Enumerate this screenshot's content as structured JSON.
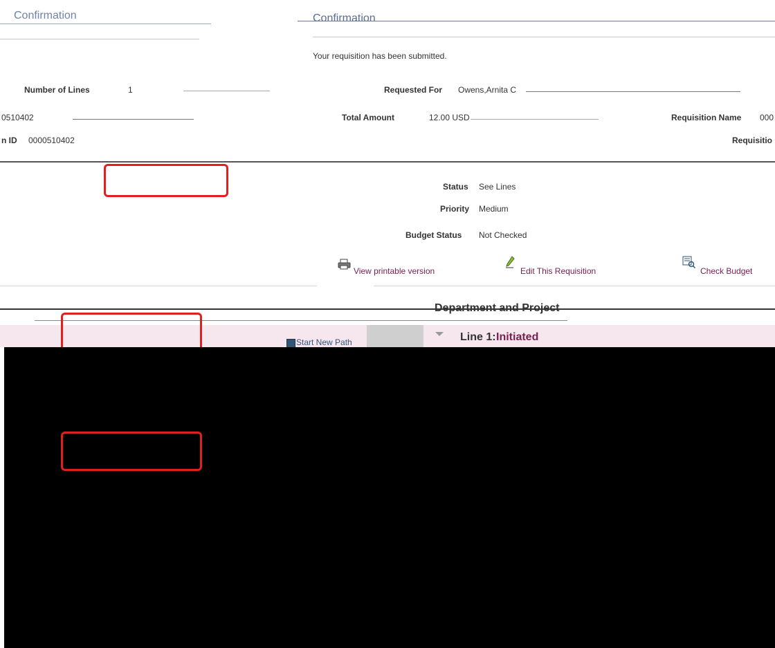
{
  "confirmation": {
    "left_title": "Confirmation",
    "main_title": "Confirmation",
    "message": "Your requisition has been submitted."
  },
  "summary": {
    "number_of_lines_label": "Number of Lines",
    "number_of_lines_value": "1",
    "left_id_fragment": "0510402",
    "requested_for_label": "Requested For",
    "requested_for_value": "Owens,Arnita C",
    "total_amount_label": "Total Amount",
    "total_amount_value": "12.00 USD",
    "requisition_name_label": "Requisition Name",
    "requisition_name_value": "000",
    "requisition_id_label": "n ID",
    "requisition_id_value": "0000510402",
    "requisition_right_label": "Requisitio"
  },
  "details": {
    "status_label": "Status",
    "status_value": "See Lines",
    "priority_label": "Priority",
    "priority_value": "Medium",
    "budget_status_label": "Budget Status",
    "budget_status_value": "Not Checked"
  },
  "actions": {
    "view_printable": "View printable version",
    "edit_requisition": "Edit This Requisition",
    "check_budget": "Check Budget"
  },
  "lower": {
    "department_header": "Department and Project",
    "start_new_path": "Start New Path",
    "line_label": "Line 1:",
    "line_status": "Initiated"
  },
  "colors": {
    "accent": "#7a2050",
    "highlight": "#e02020",
    "title": "#5a6e8c",
    "band": "#f6e6ee",
    "black_area": "#000000"
  }
}
